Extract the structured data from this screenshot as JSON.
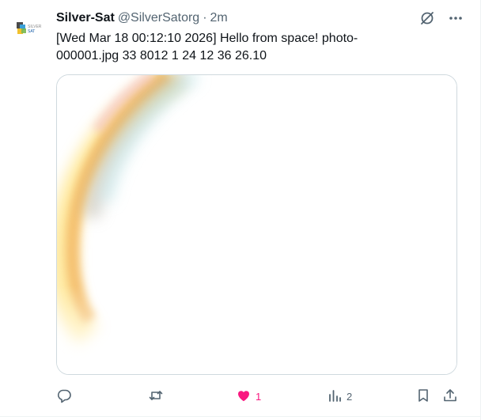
{
  "post": {
    "author_name": "Silver-Sat",
    "handle": "@SilverSatorg",
    "separator": "·",
    "time": "2m",
    "text": "[Wed Mar 18 00:12:10 2026] Hello from space! photo-000001.jpg 33 8012 1 24 12 36 26.10",
    "avatar": {
      "logo_text_top": "SILVER",
      "logo_text_bottom": "SAT"
    }
  },
  "actions": {
    "reply_count": "",
    "repost_count": "",
    "like_count": "1",
    "views_count": "2"
  },
  "colors": {
    "like_active": "#f91880",
    "muted": "#536471",
    "text": "#0f1419",
    "border": "#cfd9de"
  },
  "icons": {
    "top": [
      "grok-icon",
      "more-icon"
    ],
    "bottom": [
      "reply-icon",
      "repost-icon",
      "like-icon",
      "views-icon",
      "bookmark-icon",
      "share-icon"
    ]
  }
}
